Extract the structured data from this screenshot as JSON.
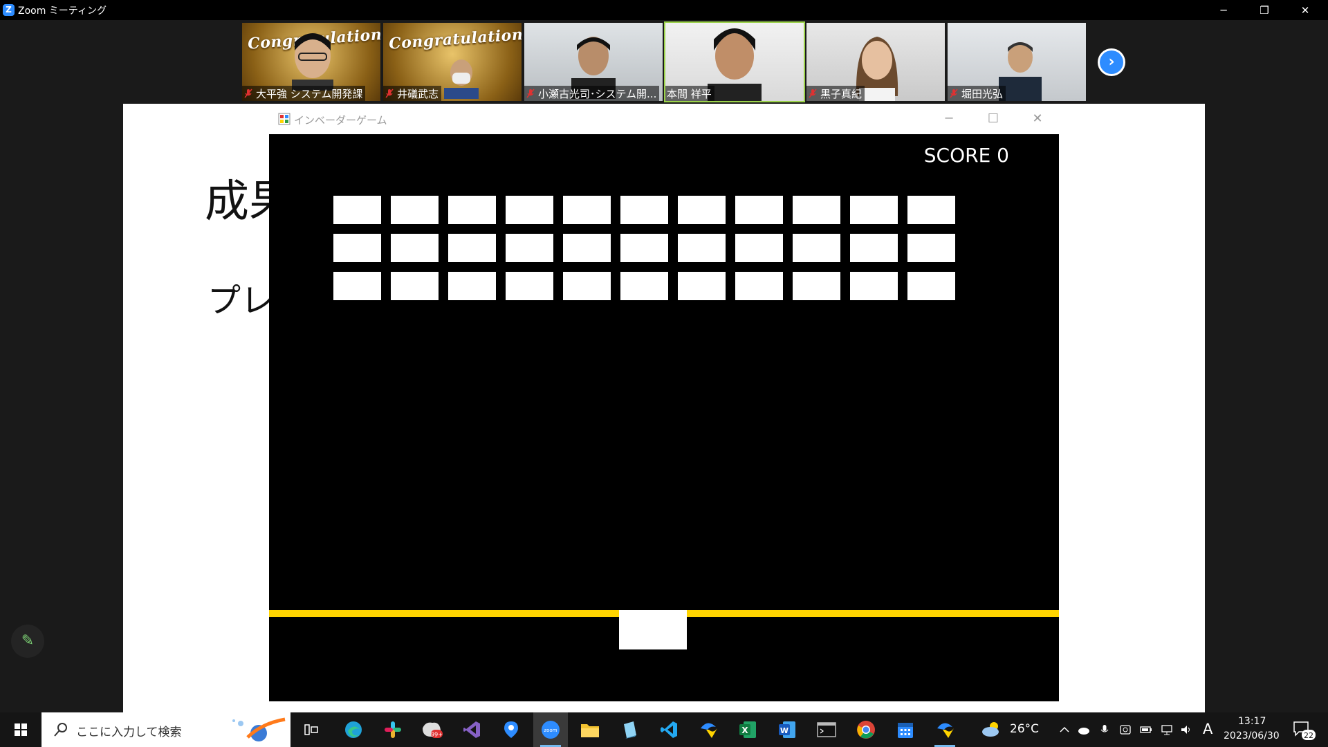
{
  "window": {
    "title": "Zoom ミーティング",
    "minimize_glyph": "─",
    "restore_glyph": "❐",
    "close_glyph": "✕"
  },
  "participants": [
    {
      "name": "大平強 システム開発課",
      "muted": true,
      "banner": "Congratulations!"
    },
    {
      "name": "井礒武志",
      "muted": true,
      "banner": "Congratulations!"
    },
    {
      "name": "小瀬古光司･システム開...",
      "muted": true
    },
    {
      "name": "本間 祥平",
      "muted": false,
      "speaking": true
    },
    {
      "name": "黒子真紀",
      "muted": true
    },
    {
      "name": "堀田光弘",
      "muted": true
    }
  ],
  "strip_next_glyph": "›",
  "slide": {
    "title_fragment": "成果",
    "subtitle_fragment": "プレ"
  },
  "game_window": {
    "title": "インベーダーゲーム",
    "minimize_glyph": "─",
    "maximize_glyph": "☐",
    "close_glyph": "✕",
    "score_text": "SCORE 0",
    "invader_rows": 3,
    "invader_cols": 11
  },
  "colors": {
    "zoom_blue": "#2d8cff",
    "ground_yellow": "#ffd400",
    "active_speaker_border": "#9bd24a"
  },
  "annotate_glyph": "✎",
  "taskbar": {
    "search_placeholder": "ここに入力して検索",
    "apps": [
      "task-view",
      "edge",
      "slack",
      "mail",
      "visual-studio",
      "maps",
      "zoom",
      "file-explorer",
      "notepad",
      "vscode",
      "dev-tool",
      "excel",
      "word",
      "terminal",
      "chrome",
      "calendar",
      "tool"
    ],
    "active_app": "zoom",
    "mail_badge": "99+",
    "weather": "26°C",
    "ime": "A",
    "time": "13:17",
    "date": "2023/06/30",
    "notification_count": "22"
  }
}
